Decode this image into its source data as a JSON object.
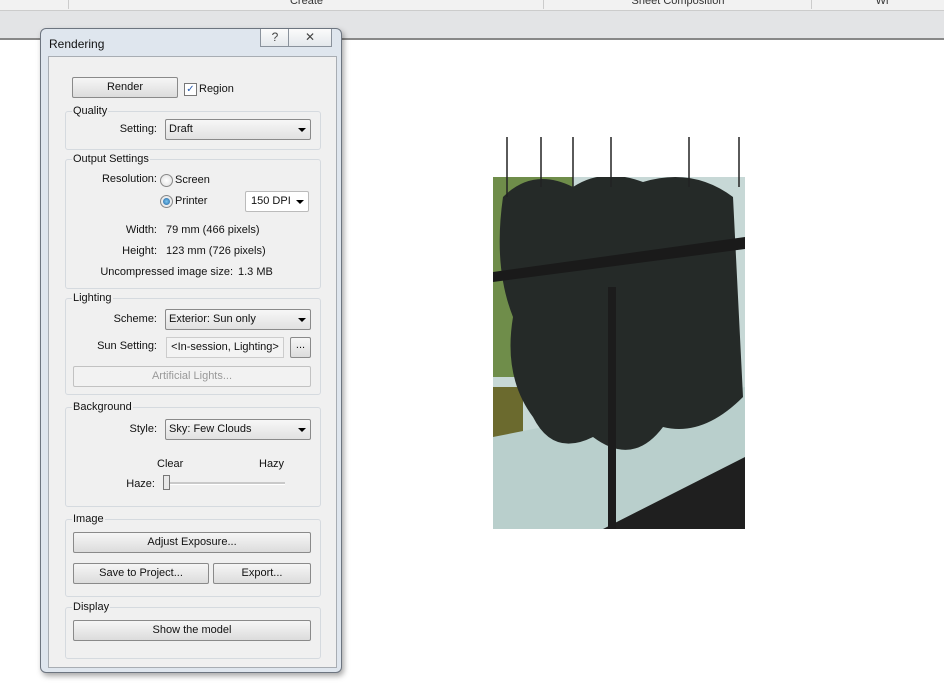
{
  "ribbon": {
    "tabs": [
      "Create",
      "Sheet Composition",
      "Wi"
    ]
  },
  "dialog": {
    "title": "Rendering",
    "help_label": "?",
    "close_label": "✕",
    "render_button": "Render",
    "region_label": "Region",
    "region_checked": true,
    "quality": {
      "label": "Quality",
      "setting_label": "Setting:",
      "setting_value": "Draft"
    },
    "output": {
      "label": "Output Settings",
      "resolution_label": "Resolution:",
      "screen_label": "Screen",
      "printer_label": "Printer",
      "selected": "Printer",
      "dpi": "150 DPI",
      "width_label": "Width:",
      "width_value": "79 mm (466 pixels)",
      "height_label": "Height:",
      "height_value": "123 mm (726 pixels)",
      "size_label": "Uncompressed image size:",
      "size_value": "1.3 MB"
    },
    "lighting": {
      "label": "Lighting",
      "scheme_label": "Scheme:",
      "scheme_value": "Exterior: Sun only",
      "sun_label": "Sun Setting:",
      "sun_value": "<In-session, Lighting>",
      "browse_label": "...",
      "artificial_button": "Artificial Lights..."
    },
    "background": {
      "label": "Background",
      "style_label": "Style:",
      "style_value": "Sky: Few Clouds",
      "clear_label": "Clear",
      "hazy_label": "Hazy",
      "haze_label": "Haze:",
      "haze_value": 0
    },
    "image": {
      "label": "Image",
      "adjust_button": "Adjust Exposure...",
      "save_button": "Save to Project...",
      "export_button": "Export..."
    },
    "display": {
      "label": "Display",
      "show_model_button": "Show the model"
    }
  }
}
